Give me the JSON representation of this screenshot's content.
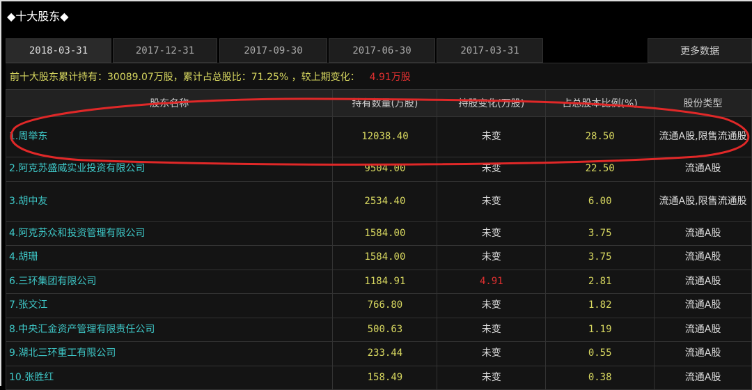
{
  "title": "◆十大股东◆",
  "tabs": [
    "2018-03-31",
    "2017-12-31",
    "2017-09-30",
    "2017-06-30",
    "2017-03-31"
  ],
  "more_label": "更多数据",
  "summary": {
    "text": "前十大股东累计持有：30089.07万股，累计占总股比：71.25% ，较上期变化：",
    "change": "4.91万股"
  },
  "columns": [
    "股东名称",
    "持有数量(万股)",
    "持股变化(万股)",
    "占总股本比例(%)",
    "股份类型"
  ],
  "rows": [
    {
      "name": "1.周举东",
      "holding": "12038.40",
      "change": "未变",
      "ratio": "28.50",
      "type": "流通A股,限售流通股"
    },
    {
      "name": "2.阿克苏盛威实业投资有限公司",
      "holding": "9504.00",
      "change": "未变",
      "ratio": "22.50",
      "type": "流通A股"
    },
    {
      "name": "3.胡中友",
      "holding": "2534.40",
      "change": "未变",
      "ratio": "6.00",
      "type": "流通A股,限售流通股"
    },
    {
      "name": "4.阿克苏众和投资管理有限公司",
      "holding": "1584.00",
      "change": "未变",
      "ratio": "3.75",
      "type": "流通A股"
    },
    {
      "name": "4.胡珊",
      "holding": "1584.00",
      "change": "未变",
      "ratio": "3.75",
      "type": "流通A股"
    },
    {
      "name": "6.三环集团有限公司",
      "holding": "1184.91",
      "change": "4.91",
      "ratio": "2.81",
      "type": "流通A股"
    },
    {
      "name": "7.张文江",
      "holding": "766.80",
      "change": "未变",
      "ratio": "1.82",
      "type": "流通A股"
    },
    {
      "name": "8.中央汇金资产管理有限责任公司",
      "holding": "500.63",
      "change": "未变",
      "ratio": "1.19",
      "type": "流通A股"
    },
    {
      "name": "9.湖北三环重工有限公司",
      "holding": "233.44",
      "change": "未变",
      "ratio": "0.55",
      "type": "流通A股"
    },
    {
      "name": "10.张胜红",
      "holding": "158.49",
      "change": "未变",
      "ratio": "0.38",
      "type": "流通A股"
    }
  ]
}
